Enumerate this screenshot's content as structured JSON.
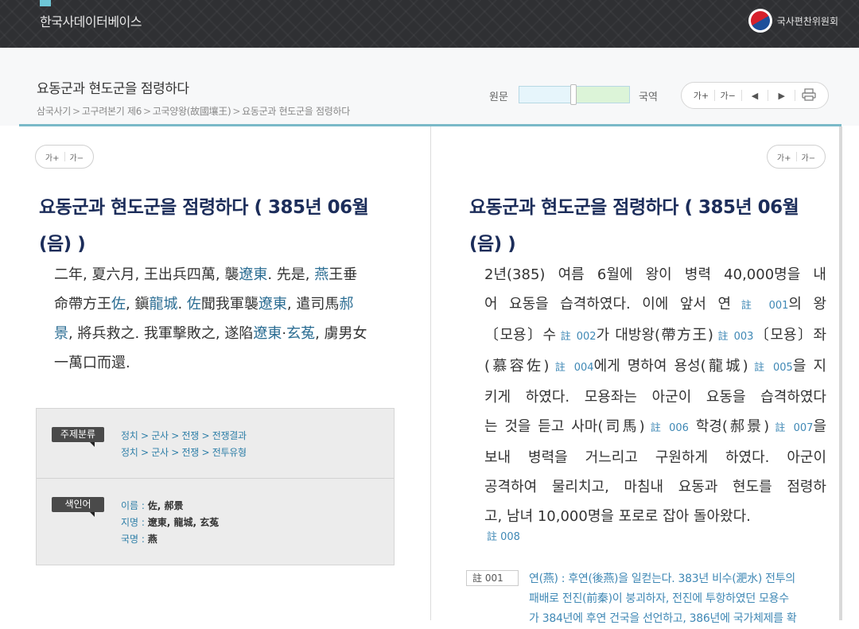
{
  "site": {
    "title": "한국사데이터베이스",
    "org": "국사편찬위원회"
  },
  "header": {
    "page_title": "요동군과 현도군을 점령하다",
    "breadcrumb": [
      "삼국사기",
      "고구려본기 제6",
      "고국양왕(故國壤王)",
      "요동군과 현도군을 점령하다"
    ],
    "ratio_left_label": "원문",
    "ratio_right_label": "국역",
    "tools": {
      "font_up": "가+",
      "font_down": "가−",
      "prev": "◀",
      "next": "▶",
      "print_icon": "print-icon"
    }
  },
  "left": {
    "font_up": "가+",
    "font_down": "가−",
    "title_line1": "요동군과 현도군을 점령하다 ( 385년 06월",
    "title_line2": "(음) )",
    "text_lines": [
      [
        "二年, 夏六月, 王出兵四萬, 襲",
        {
          "kw": "遼東"
        },
        ". 先是, ",
        {
          "kw": "燕"
        },
        "王垂"
      ],
      [
        "命帶方王",
        {
          "kw": "佐"
        },
        ", 鎭",
        {
          "kw": "龍城"
        },
        ". ",
        {
          "kw": "佐"
        },
        "聞我軍襲",
        {
          "kw": "遼東"
        },
        ", 遣司馬",
        {
          "kw": "郝"
        }
      ],
      [
        {
          "kw": "景"
        },
        ", 將兵救之. 我軍擊敗之, 遂陷",
        {
          "kw": "遼東"
        },
        "·",
        {
          "kw": "玄菟"
        },
        ", 虜男女"
      ],
      [
        "一萬口而還."
      ]
    ],
    "topic_tag": "주제분류",
    "topics": [
      "정치 > 군사 > 전쟁 > 전쟁결과",
      "정치 > 군사 > 전쟁 > 전투유형"
    ],
    "index_tag": "색인어",
    "index": [
      {
        "label": "이름 : ",
        "value": "佐, 郝景"
      },
      {
        "label": "지명 : ",
        "value": "遼東, 龍城, 玄菟"
      },
      {
        "label": "국명 : ",
        "value": "燕"
      }
    ]
  },
  "right": {
    "font_up": "가+",
    "font_down": "가−",
    "title_line1": "요동군과 현도군을 점령하다 ( 385년 06월",
    "title_line2": "(음) )",
    "text_lines": [
      [
        "2년(385) 여름 6월에 왕이 병력 40,000명을 내"
      ],
      [
        "어 요동을 습격하였다. 이에 앞서 연",
        {
          "note": "註 001"
        },
        "의 왕"
      ],
      [
        "〔모용〕수",
        {
          "note": "註 002"
        },
        "가 대방왕(帶方王)",
        {
          "note": "註 003"
        },
        "〔모용〕좌"
      ],
      [
        "(慕容佐)",
        {
          "note": "註 004"
        },
        "에게 명하여 용성(龍城)",
        {
          "note": "註 005"
        },
        "을 지"
      ],
      [
        "키게 하였다. 모용좌는 아군이 요동을 습격하였다"
      ],
      [
        "는 것을 듣고 사마(司馬)",
        {
          "note": "註 006"
        },
        " 학경(郝景)",
        {
          "note": "註 007"
        },
        "을"
      ],
      [
        "보내 병력을 거느리고 구원하게 하였다. 아군이"
      ],
      [
        "공격하여 물리치고, 마침내 요동과 현도를 점령하"
      ],
      [
        "고, 남녀 10,000명을 포로로 잡아 돌아왔다."
      ]
    ],
    "last_note": "註 008",
    "footnote_badge": "註 001",
    "footnote_lines": [
      "연(燕) : 후연(後燕)을 일컫는다. 383년 비수(淝水) 전투의",
      "패배로 전진(前秦)이 붕괴하자, 전진에 투항하였던 모용수",
      "가 384년에 후연 건국을 선언하고, 386년에 국가체제를 확"
    ]
  }
}
